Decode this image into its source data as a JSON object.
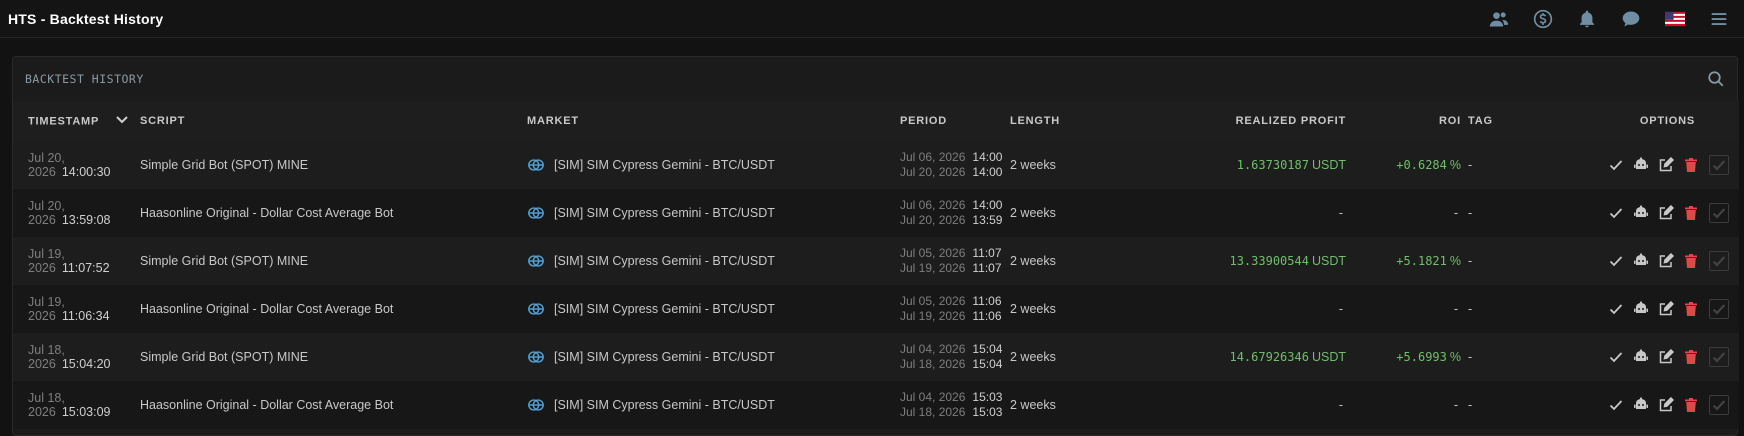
{
  "app": {
    "title": "HTS - Backtest History"
  },
  "topbar": {
    "icons": [
      "users-icon",
      "dollar-circle-icon",
      "bell-icon",
      "chat-icon",
      "us-flag-icon",
      "menu-icon"
    ]
  },
  "panel": {
    "title": "BACKTEST HISTORY"
  },
  "table": {
    "columns": {
      "timestamp": "TIMESTAMP",
      "script": "SCRIPT",
      "market": "MARKET",
      "period": "PERIOD",
      "length": "LENGTH",
      "realized_profit": "REALIZED PROFIT",
      "roi": "ROI",
      "tag": "TAG",
      "options": "OPTIONS"
    },
    "rows": [
      {
        "date": "Jul 20, 2026",
        "time": "14:00:30",
        "script": "Simple Grid Bot (SPOT) MINE",
        "market": "[SIM] SIM Cypress Gemini - BTC/USDT",
        "p_start_date": "Jul 06, 2026",
        "p_start_time": "14:00",
        "p_end_date": "Jul 20, 2026",
        "p_end_time": "14:00",
        "length": "2 weeks",
        "profit": "1.63730187",
        "profit_unit": "USDT",
        "roi": "+0.6284",
        "roi_unit": "%",
        "tag": "-"
      },
      {
        "date": "Jul 20, 2026",
        "time": "13:59:08",
        "script": "Haasonline Original - Dollar Cost Average Bot",
        "market": "[SIM] SIM Cypress Gemini - BTC/USDT",
        "p_start_date": "Jul 06, 2026",
        "p_start_time": "14:00",
        "p_end_date": "Jul 20, 2026",
        "p_end_time": "13:59",
        "length": "2 weeks",
        "profit": "-",
        "profit_unit": "",
        "roi": "-",
        "roi_unit": "",
        "tag": "-"
      },
      {
        "date": "Jul 19, 2026",
        "time": "11:07:52",
        "script": "Simple Grid Bot (SPOT) MINE",
        "market": "[SIM] SIM Cypress Gemini - BTC/USDT",
        "p_start_date": "Jul 05, 2026",
        "p_start_time": "11:07",
        "p_end_date": "Jul 19, 2026",
        "p_end_time": "11:07",
        "length": "2 weeks",
        "profit": "13.33900544",
        "profit_unit": "USDT",
        "roi": "+5.1821",
        "roi_unit": "%",
        "tag": "-"
      },
      {
        "date": "Jul 19, 2026",
        "time": "11:06:34",
        "script": "Haasonline Original - Dollar Cost Average Bot",
        "market": "[SIM] SIM Cypress Gemini - BTC/USDT",
        "p_start_date": "Jul 05, 2026",
        "p_start_time": "11:06",
        "p_end_date": "Jul 19, 2026",
        "p_end_time": "11:06",
        "length": "2 weeks",
        "profit": "-",
        "profit_unit": "",
        "roi": "-",
        "roi_unit": "",
        "tag": "-"
      },
      {
        "date": "Jul 18, 2026",
        "time": "15:04:20",
        "script": "Simple Grid Bot (SPOT) MINE",
        "market": "[SIM] SIM Cypress Gemini - BTC/USDT",
        "p_start_date": "Jul 04, 2026",
        "p_start_time": "15:04",
        "p_end_date": "Jul 18, 2026",
        "p_end_time": "15:04",
        "length": "2 weeks",
        "profit": "14.67926346",
        "profit_unit": "USDT",
        "roi": "+5.6993",
        "roi_unit": "%",
        "tag": "-"
      },
      {
        "date": "Jul 18, 2026",
        "time": "15:03:09",
        "script": "Haasonline Original - Dollar Cost Average Bot",
        "market": "[SIM] SIM Cypress Gemini - BTC/USDT",
        "p_start_date": "Jul 04, 2026",
        "p_start_time": "15:03",
        "p_end_date": "Jul 18, 2026",
        "p_end_time": "15:03",
        "length": "2 weeks",
        "profit": "-",
        "profit_unit": "",
        "roi": "-",
        "roi_unit": "",
        "tag": "-"
      }
    ]
  },
  "colors": {
    "background": "#121212",
    "panel": "#1b1b1b",
    "profit_green": "#6fbf6a",
    "delete_red": "#e04848",
    "icon_blue": "#6f8ea3",
    "market_icon": "#4fa3d9"
  }
}
